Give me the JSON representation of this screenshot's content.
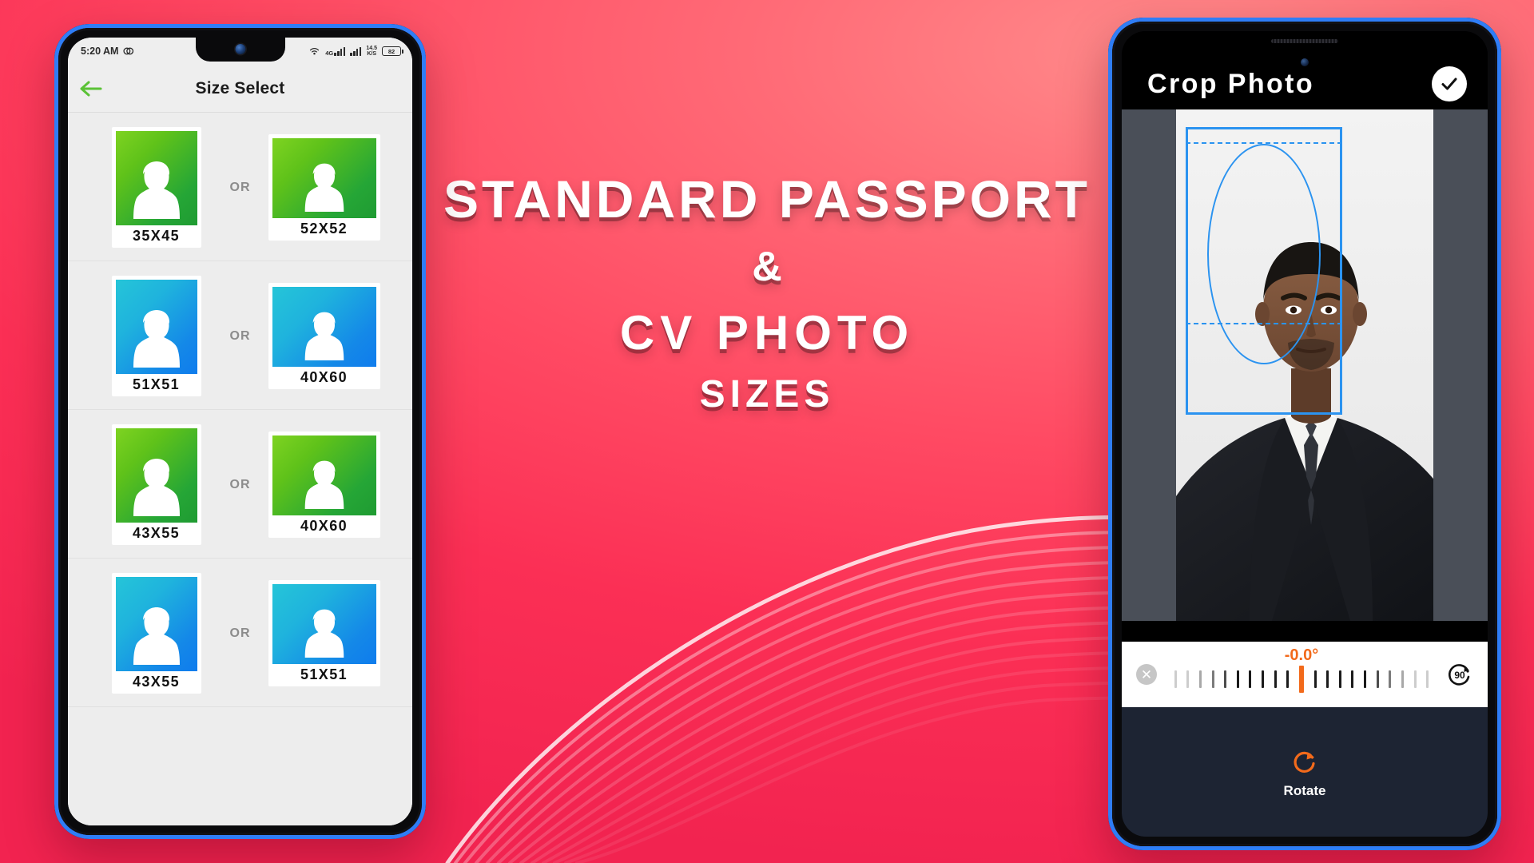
{
  "background": {
    "accent_pink": "#ff3355",
    "accent_pink_light": "#ff8b8b"
  },
  "promo": {
    "line1": "STANDARD PASSPORT",
    "amp": "&",
    "line2": "CV PHOTO",
    "line3": "SIZES"
  },
  "left_phone": {
    "status_bar": {
      "time": "5:20 AM",
      "notification_icon": "whatsapp-icon",
      "wifi_icon": "wifi-icon",
      "network_label": "4G",
      "signal_icon": "signal-bars-icon",
      "signal2_icon": "signal-bars-icon",
      "data_speed": "14.5",
      "data_speed_unit": "K/S",
      "battery_level": "82"
    },
    "app_bar": {
      "back_icon": "back-arrow-icon",
      "title": "Size Select",
      "accent": "#5bc236"
    },
    "rows": [
      {
        "left": {
          "label": "35X45",
          "color": "green",
          "shape": "portrait",
          "icon": "person-silhouette-icon"
        },
        "separator": "OR",
        "right": {
          "label": "52X52",
          "color": "green",
          "shape": "wide",
          "icon": "person-silhouette-icon"
        }
      },
      {
        "left": {
          "label": "51X51",
          "color": "blue",
          "shape": "portrait",
          "icon": "person-silhouette-icon"
        },
        "separator": "OR",
        "right": {
          "label": "40X60",
          "color": "blue",
          "shape": "wide",
          "icon": "person-silhouette-icon"
        }
      },
      {
        "left": {
          "label": "43X55",
          "color": "green",
          "shape": "portrait",
          "icon": "person-silhouette-icon"
        },
        "separator": "OR",
        "right": {
          "label": "40X60",
          "color": "green",
          "shape": "wide",
          "icon": "person-silhouette-icon"
        }
      },
      {
        "left": {
          "label": "43X55",
          "color": "blue",
          "shape": "portrait",
          "icon": "person-silhouette-icon"
        },
        "separator": "OR",
        "right": {
          "label": "51X51",
          "color": "blue",
          "shape": "wide",
          "icon": "person-silhouette-icon"
        }
      }
    ]
  },
  "right_phone": {
    "header": {
      "title": "Crop Photo",
      "done_icon": "check-circle-icon"
    },
    "crop": {
      "frame_color": "#2b93f0",
      "guide_icon": "face-oval-guide-icon"
    },
    "rotate": {
      "angle_value": "-0.0°",
      "angle_color": "#f26a1b",
      "close_icon": "close-circle-icon",
      "reset_90_label": "90",
      "reset_90_suffix": "°",
      "reset_90_icon": "rotate-90-icon",
      "action_icon": "rotate-cw-icon",
      "action_label": "Rotate"
    }
  }
}
